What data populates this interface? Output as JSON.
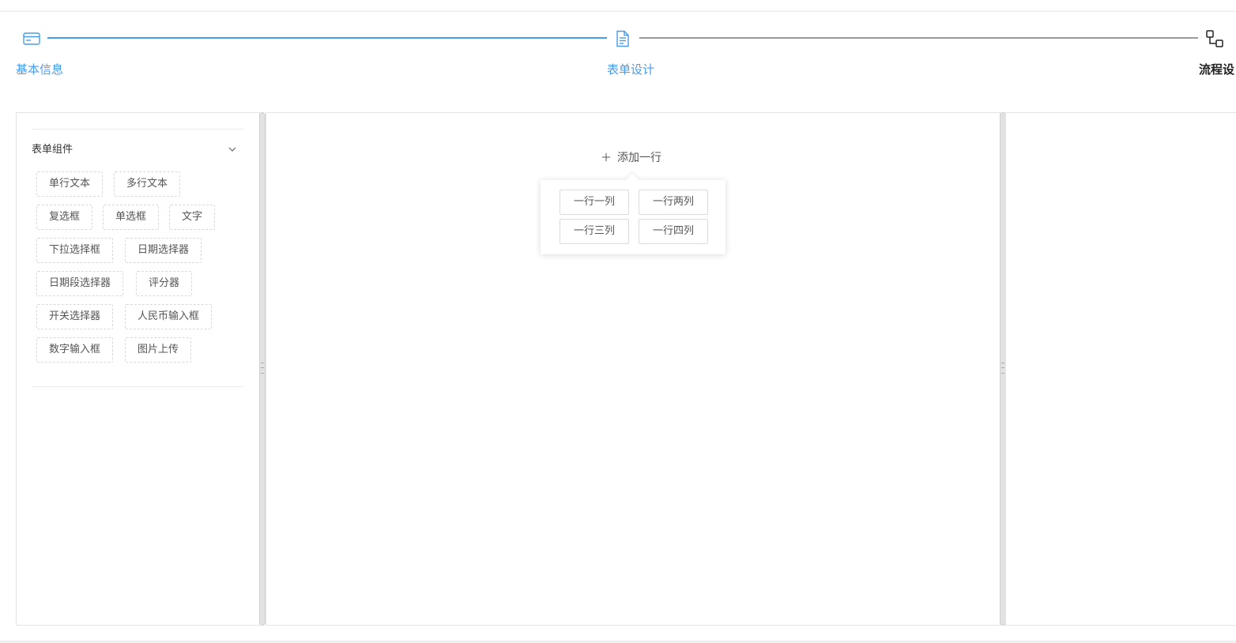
{
  "steps": [
    {
      "label": "基本信息",
      "icon": "credit-card-icon",
      "state": "done"
    },
    {
      "label": "表单设计",
      "icon": "document-icon",
      "state": "done"
    },
    {
      "label": "流程设",
      "icon": "flow-nodes-icon",
      "state": "current"
    }
  ],
  "colors": {
    "accent": "#4a9be8",
    "line_inactive": "#999999",
    "text_current": "#222222"
  },
  "palette": {
    "title": "表单组件",
    "items": [
      "单行文本",
      "多行文本",
      "复选框",
      "单选框",
      "文字",
      "下拉选择框",
      "日期选择器",
      "日期段选择器",
      "评分器",
      "开关选择器",
      "人民币输入框",
      "数字输入框",
      "图片上传"
    ]
  },
  "canvas": {
    "add_row_label": "添加一行",
    "layout_options": [
      "一行一列",
      "一行两列",
      "一行三列",
      "一行四列"
    ]
  }
}
